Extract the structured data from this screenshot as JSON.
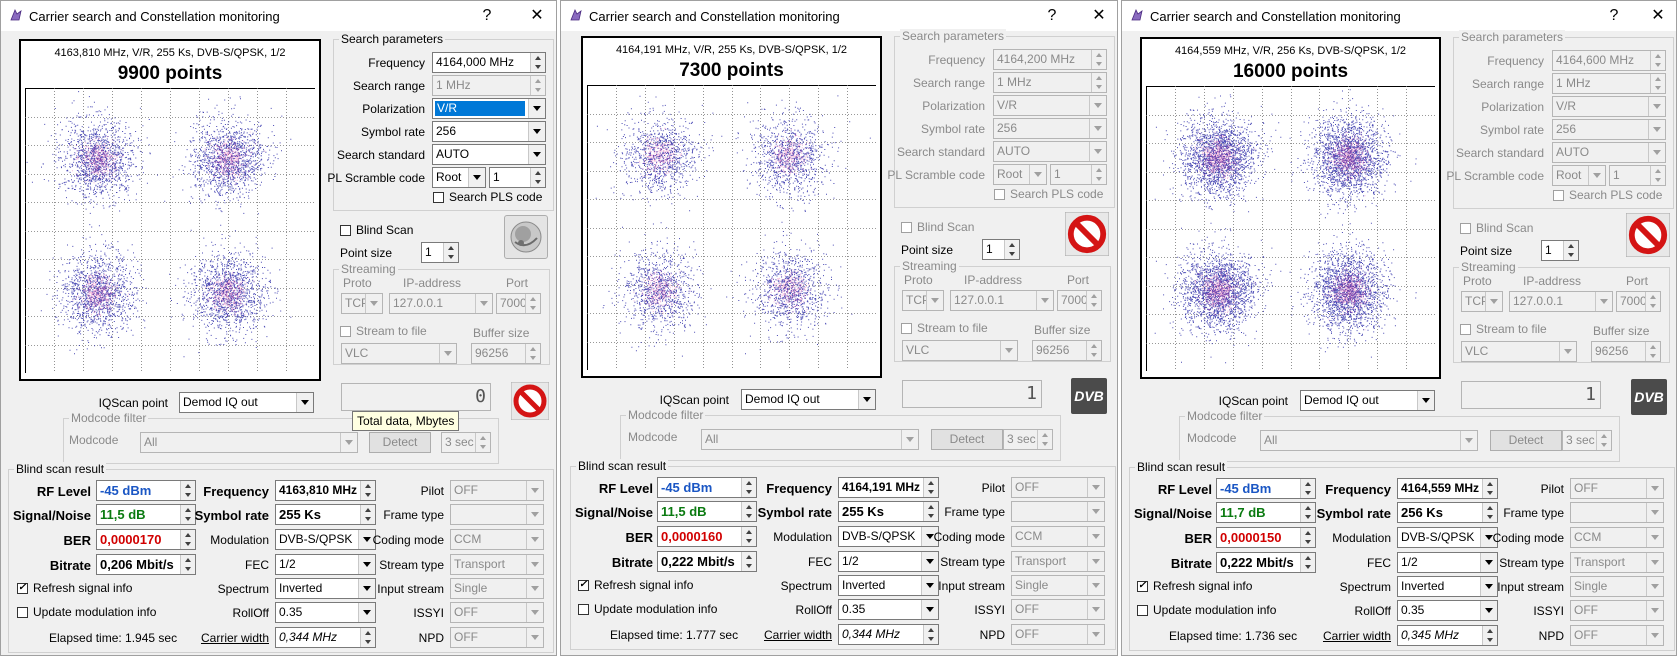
{
  "windows": [
    {
      "title": "Carrier search and Constellation monitoring",
      "help_label": "?",
      "close_label": "✕",
      "scatter": {
        "header": "4163,810 MHz, V/R, 255 Ks, DVB-S/QPSK, 1/2",
        "points": "9900 points"
      },
      "search_params": {
        "title": "Search parameters",
        "frequency_label": "Frequency",
        "frequency": "4164,000 MHz",
        "search_range_label": "Search range",
        "search_range": "1 MHz",
        "polarization_label": "Polarization",
        "polarization": "V/R",
        "symbol_rate_label": "Symbol rate",
        "symbol_rate": "256",
        "search_standard_label": "Search standard",
        "search_standard": "AUTO",
        "pl_scramble_label": "PL Scramble code",
        "pl_scramble_mode": "Root",
        "pl_scramble_value": "1",
        "search_pls_label": "Search PLS code"
      },
      "blind_scan_label": "Blind Scan",
      "point_size_label": "Point size",
      "point_size": "1",
      "streaming": {
        "title": "Streaming",
        "proto_label": "Proto",
        "ip_label": "IP-address",
        "port_label": "Port",
        "proto": "TCP",
        "ip": "127.0.0.1",
        "port": "7000",
        "stream_to_file_label": "Stream to file",
        "buffer_size_label": "Buffer size",
        "player": "VLC",
        "buffer_size": "96256"
      },
      "total_data_value": "0",
      "iqscan_label": "IQScan point",
      "iqscan_value": "Demod IQ out",
      "modcode_filter": {
        "title": "Modcode filter",
        "modcode_label": "Modcode",
        "modcode_value": "All",
        "detect_label": "Detect",
        "detect_time": "3 sec"
      },
      "tooltip": "Total data, Mbytes",
      "blind_scan_result": {
        "title": "Blind scan result",
        "rf_level_label": "RF Level",
        "rf_level": "-45 dBm",
        "snr_label": "Signal/Noise",
        "snr": "11,5 dB",
        "ber_label": "BER",
        "ber": "0,0000170",
        "bitrate_label": "Bitrate",
        "bitrate": "0,206 Mbit/s",
        "frequency_label": "Frequency",
        "frequency": "4163,810 MHz",
        "symbol_rate_label": "Symbol rate",
        "symbol_rate": "255 Ks",
        "modulation_label": "Modulation",
        "modulation": "DVB-S/QPSK",
        "fec_label": "FEC",
        "fec": "1/2",
        "spectrum_label": "Spectrum",
        "spectrum": "Inverted",
        "rolloff_label": "RollOff",
        "rolloff": "0.35",
        "carrier_width_label": "Carrier width",
        "carrier_width": "0,344 MHz",
        "pilot_label": "Pilot",
        "pilot": "OFF",
        "frame_type_label": "Frame type",
        "frame_type": "",
        "coding_mode_label": "Coding mode",
        "coding_mode": "CCM",
        "stream_type_label": "Stream type",
        "stream_type": "Transport",
        "input_stream_label": "Input stream",
        "input_stream": "Single",
        "issyi_label": "ISSYI",
        "issyi": "OFF",
        "npd_label": "NPD",
        "npd": "OFF",
        "refresh_label": "Refresh signal info",
        "update_mod_label": "Update modulation info",
        "elapsed": "Elapsed time: 1.945 sec"
      }
    },
    {
      "title": "Carrier search and Constellation monitoring",
      "help_label": "?",
      "close_label": "✕",
      "scatter": {
        "header": "4164,191 MHz, V/R, 255 Ks, DVB-S/QPSK, 1/2",
        "points": "7300 points"
      },
      "search_params": {
        "title": "Search parameters",
        "frequency_label": "Frequency",
        "frequency": "4164,200 MHz",
        "search_range_label": "Search range",
        "search_range": "1 MHz",
        "polarization_label": "Polarization",
        "polarization": "V/R",
        "symbol_rate_label": "Symbol rate",
        "symbol_rate": "256",
        "search_standard_label": "Search standard",
        "search_standard": "AUTO",
        "pl_scramble_label": "PL Scramble code",
        "pl_scramble_mode": "Root",
        "pl_scramble_value": "1",
        "search_pls_label": "Search PLS code"
      },
      "blind_scan_label": "Blind Scan",
      "point_size_label": "Point size",
      "point_size": "1",
      "streaming": {
        "title": "Streaming",
        "proto_label": "Proto",
        "ip_label": "IP-address",
        "port_label": "Port",
        "proto": "TCP",
        "ip": "127.0.0.1",
        "port": "7000",
        "stream_to_file_label": "Stream to file",
        "buffer_size_label": "Buffer size",
        "player": "VLC",
        "buffer_size": "96256"
      },
      "total_data_value": "1",
      "iqscan_label": "IQScan point",
      "iqscan_value": "Demod IQ out",
      "modcode_filter": {
        "title": "Modcode filter",
        "modcode_label": "Modcode",
        "modcode_value": "All",
        "detect_label": "Detect",
        "detect_time": "3 sec"
      },
      "dvb_logo": "DVB",
      "blind_scan_result": {
        "title": "Blind scan result",
        "rf_level_label": "RF Level",
        "rf_level": "-45 dBm",
        "snr_label": "Signal/Noise",
        "snr": "11,5 dB",
        "ber_label": "BER",
        "ber": "0,0000160",
        "bitrate_label": "Bitrate",
        "bitrate": "0,222 Mbit/s",
        "frequency_label": "Frequency",
        "frequency": "4164,191 MHz",
        "symbol_rate_label": "Symbol rate",
        "symbol_rate": "255 Ks",
        "modulation_label": "Modulation",
        "modulation": "DVB-S/QPSK",
        "fec_label": "FEC",
        "fec": "1/2",
        "spectrum_label": "Spectrum",
        "spectrum": "Inverted",
        "rolloff_label": "RollOff",
        "rolloff": "0.35",
        "carrier_width_label": "Carrier width",
        "carrier_width": "0,344 MHz",
        "pilot_label": "Pilot",
        "pilot": "OFF",
        "frame_type_label": "Frame type",
        "frame_type": "",
        "coding_mode_label": "Coding mode",
        "coding_mode": "CCM",
        "stream_type_label": "Stream type",
        "stream_type": "Transport",
        "input_stream_label": "Input stream",
        "input_stream": "Single",
        "issyi_label": "ISSYI",
        "issyi": "OFF",
        "npd_label": "NPD",
        "npd": "OFF",
        "refresh_label": "Refresh signal info",
        "update_mod_label": "Update modulation info",
        "elapsed": "Elapsed time: 1.777 sec"
      }
    },
    {
      "title": "Carrier search and Constellation monitoring",
      "help_label": "?",
      "close_label": "✕",
      "scatter": {
        "header": "4164,559 MHz, V/R, 256 Ks, DVB-S/QPSK, 1/2",
        "points": "16000 points"
      },
      "search_params": {
        "title": "Search parameters",
        "frequency_label": "Frequency",
        "frequency": "4164,600 MHz",
        "search_range_label": "Search range",
        "search_range": "1 MHz",
        "polarization_label": "Polarization",
        "polarization": "V/R",
        "symbol_rate_label": "Symbol rate",
        "symbol_rate": "256",
        "search_standard_label": "Search standard",
        "search_standard": "AUTO",
        "pl_scramble_label": "PL Scramble code",
        "pl_scramble_mode": "Root",
        "pl_scramble_value": "1",
        "search_pls_label": "Search PLS code"
      },
      "blind_scan_label": "Blind Scan",
      "point_size_label": "Point size",
      "point_size": "1",
      "streaming": {
        "title": "Streaming",
        "proto_label": "Proto",
        "ip_label": "IP-address",
        "port_label": "Port",
        "proto": "TCP",
        "ip": "127.0.0.1",
        "port": "7000",
        "stream_to_file_label": "Stream to file",
        "buffer_size_label": "Buffer size",
        "player": "VLC",
        "buffer_size": "96256"
      },
      "total_data_value": "1",
      "iqscan_label": "IQScan point",
      "iqscan_value": "Demod IQ out",
      "modcode_filter": {
        "title": "Modcode filter",
        "modcode_label": "Modcode",
        "modcode_value": "All",
        "detect_label": "Detect",
        "detect_time": "3 sec"
      },
      "dvb_logo": "DVB",
      "blind_scan_result": {
        "title": "Blind scan result",
        "rf_level_label": "RF Level",
        "rf_level": "-45 dBm",
        "snr_label": "Signal/Noise",
        "snr": "11,7 dB",
        "ber_label": "BER",
        "ber": "0,0000150",
        "bitrate_label": "Bitrate",
        "bitrate": "0,222 Mbit/s",
        "frequency_label": "Frequency",
        "frequency": "4164,559 MHz",
        "symbol_rate_label": "Symbol rate",
        "symbol_rate": "256 Ks",
        "modulation_label": "Modulation",
        "modulation": "DVB-S/QPSK",
        "fec_label": "FEC",
        "fec": "1/2",
        "spectrum_label": "Spectrum",
        "spectrum": "Inverted",
        "rolloff_label": "RollOff",
        "rolloff": "0.35",
        "carrier_width_label": "Carrier width",
        "carrier_width": "0,345 MHz",
        "pilot_label": "Pilot",
        "pilot": "OFF",
        "frame_type_label": "Frame type",
        "frame_type": "",
        "coding_mode_label": "Coding mode",
        "coding_mode": "CCM",
        "stream_type_label": "Stream type",
        "stream_type": "Transport",
        "input_stream_label": "Input stream",
        "input_stream": "Single",
        "issyi_label": "ISSYI",
        "issyi": "OFF",
        "npd_label": "NPD",
        "npd": "OFF",
        "refresh_label": "Refresh signal info",
        "update_mod_label": "Update modulation info",
        "elapsed": "Elapsed time: 1.736 sec"
      }
    }
  ],
  "colors": {
    "value_blue": "#1a56c4",
    "value_green": "#0a7a10",
    "value_red": "#d10000",
    "selection": "#0078d7",
    "constellation_dots": "#2a2aa8",
    "constellation_core": "#e040a0"
  }
}
